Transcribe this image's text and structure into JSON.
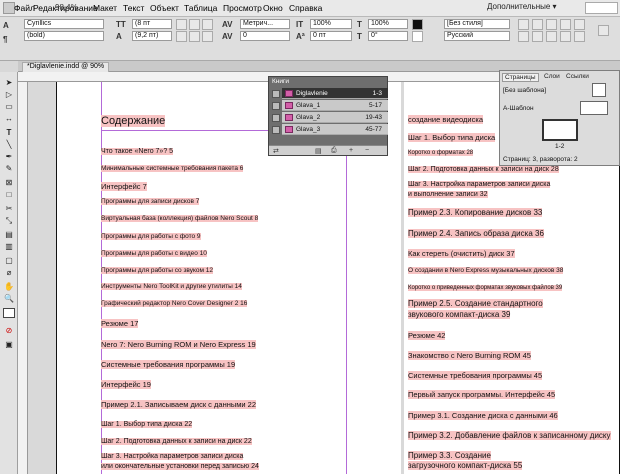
{
  "menubar": {
    "zoom": "98,4%",
    "items": [
      "Файл",
      "Редактирование",
      "Макет",
      "Текст",
      "Объект",
      "Таблица",
      "Просмотр",
      "Окно",
      "Справка"
    ],
    "workspace": "Дополнительные ▾"
  },
  "control": {
    "font_family": "Cyrillics",
    "font_style": "(bold)",
    "font_size": "(8 пт",
    "leading": "(9,2 пт)",
    "tracking_label": "Метрич...",
    "tracking_value": "0",
    "scale_v": "100%",
    "scale_h": "100%",
    "baseline": "0 пт",
    "skew": "0°",
    "char_style": "[Без стиля]",
    "language": "Русский"
  },
  "document": {
    "tab_label": "*Diglavlenie.indd @ 90%"
  },
  "toc_left": {
    "heading": "Содержание",
    "entries": [
      "Что такое «Nero 7»?   5",
      "Минимальные системные требования пакета    6",
      "Интерфейс  7",
      "Программы для записи дисков        7",
      "Виртуальная база (коллекция) файлов Nero Scout      8",
      "Программы для работы с фото          9",
      "Программы для работы с видео        10",
      "Программы для работы со звуком     12",
      "Инструменты Nero ToolKit и другие утилиты       14",
      "Графический редактор Nero Cover Designer 2     16",
      "Резюме     17",
      "Nero 7: Nero Burning ROM и Nero Express    19",
      "Системные требования программы  19",
      "Интерфейс         19",
      "Пример 2.1. Записываем диск с данными  22",
      "Шаг 1. Выбор типа диска          22",
      "Шаг 2. Подготовка данных к записи на диск         22",
      "Шаг 3. Настройка параметров записи диска",
      "или окончательные установки перед записью   24"
    ]
  },
  "toc_right": {
    "entries": [
      "создание видеодиска",
      "Шаг 1. Выбор типа диска",
      "Коротко о форматах   28",
      "Шаг 2. Подготовка данных к записи на диск      28",
      "Шаг 3. Настройка параметров записи диска",
      "и выполнение записи   32",
      "Пример 2.3. Копирование дисков     33",
      "Пример 2.4. Запись образа диска      36",
      "Как стереть (очистить) диск     37",
      "О создании в Nero Express музыкальных дисков             38",
      "Коротко о приведенных форматах звуковых файлов      39",
      "Пример 2.5. Создание стандартного",
      "звукового компакт-диска 39",
      "Резюме     42",
      "Знакомство с Nero Burning ROM          45",
      "Системные требования программы 45",
      "Первый запуск программы. Интерфейс     45",
      "Пример 3.1. Создание диска с данными     46",
      "Пример 3.2. Добавление файлов к записанному диску",
      "Пример 3.3. Создание",
      "загрузочного компакт-диска     55"
    ]
  },
  "book_panel": {
    "title": "Книги",
    "rows": [
      {
        "name": "Diglavlenie",
        "pages": "1-3"
      },
      {
        "name": "Glava_1",
        "pages": "5-17"
      },
      {
        "name": "Glava_2",
        "pages": "19-43"
      },
      {
        "name": "Glava_3",
        "pages": "45-77"
      }
    ]
  },
  "pages_panel": {
    "tabs": [
      "Страницы",
      "Слои",
      "Ссылки"
    ],
    "none_master": "[Без шаблона]",
    "master_a": "A-Шаблон",
    "spread_label": "1-2",
    "status": "Страниц: 3, разворота: 2"
  }
}
